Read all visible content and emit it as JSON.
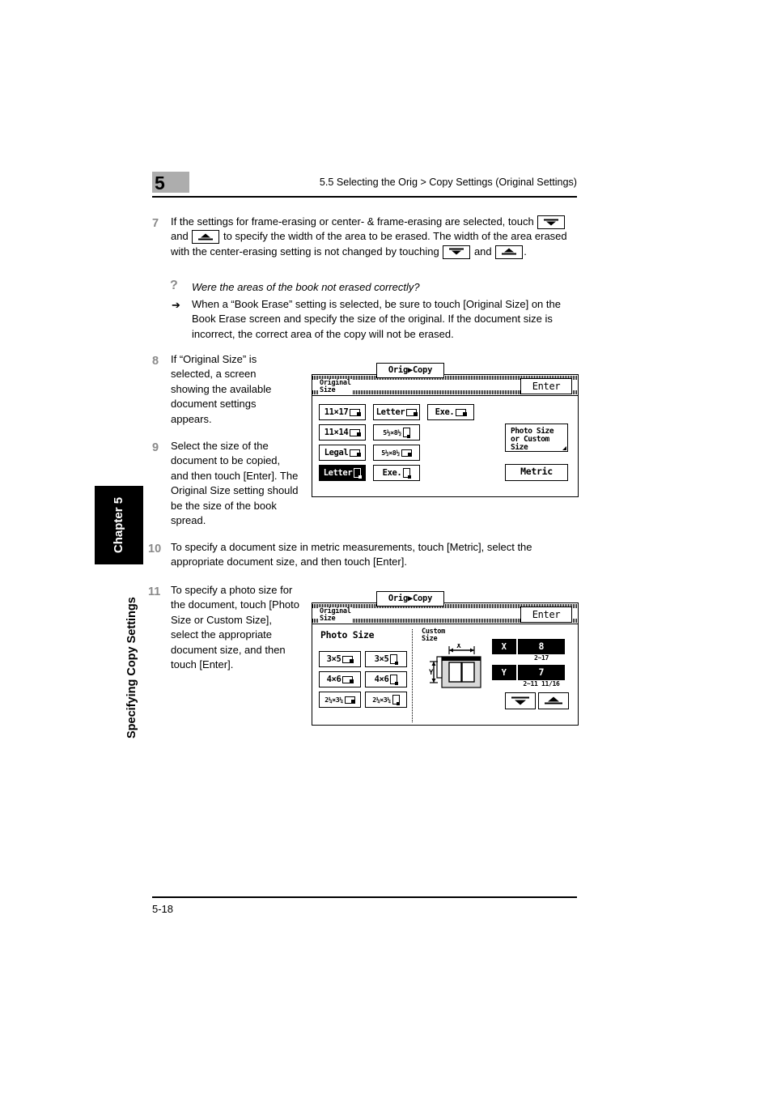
{
  "header": {
    "chapter_number": "5",
    "title": "5.5 Selecting the Orig > Copy Settings (Original Settings)"
  },
  "sidebar": {
    "chapter_tab": "Chapter 5",
    "section_title": "Specifying Copy Settings"
  },
  "footer": {
    "page_number": "5-18"
  },
  "steps": {
    "s7": {
      "number": "7",
      "part1": "If the settings for frame-erasing or center- & frame-erasing are selected, touch",
      "part2": "and",
      "part3": "to specify the width of the area to be erased. The width of the area erased with the center-erasing setting is not changed by touching",
      "part4": "and",
      "part5": "."
    },
    "s8": {
      "number": "8",
      "text": "If “Original Size” is selected, a screen showing the available document settings appears."
    },
    "s9": {
      "number": "9",
      "text": "Select the size of the document to be copied, and then touch [Enter]. The Original Size setting should be the size of the book spread."
    },
    "s10": {
      "number": "10",
      "text": "To specify a document size in metric measurements, touch [Metric], select the appropriate document size, and then touch [Enter]."
    },
    "s11": {
      "number": "11",
      "text": "To specify a photo size for the document, touch [Photo Size or Custom Size], select the appropriate document size, and then touch [Enter]."
    }
  },
  "qa": {
    "mark": "?",
    "arrow": "➔",
    "question": "Were the areas of the book not erased correctly?",
    "answer": "When a “Book Erase” setting is selected, be sure to touch [Original Size] on the Book Erase screen and specify the size of the original. If the document size is incorrect, the correct area of the copy will not be erased."
  },
  "screen1": {
    "tab_label": "Orig▶Copy",
    "title_line1": "Original",
    "title_line2": "Size",
    "enter_label": "Enter",
    "size_buttons": [
      {
        "label": "11×17",
        "orientation": "land",
        "selected": false
      },
      {
        "label": "Letter",
        "orientation": "land",
        "selected": false
      },
      {
        "label": "Exe.",
        "orientation": "land",
        "selected": false
      },
      {
        "label": "11×14",
        "orientation": "land",
        "selected": false
      },
      {
        "label": "5½×8½",
        "orientation": "port",
        "selected": false
      },
      {
        "label": "Legal",
        "orientation": "land",
        "selected": false
      },
      {
        "label": "5½×8½",
        "orientation": "land",
        "selected": false
      },
      {
        "label": "Letter",
        "orientation": "port",
        "selected": true
      },
      {
        "label": "Exe.",
        "orientation": "port",
        "selected": false
      }
    ],
    "photo_custom_button": {
      "line1": "Photo Size",
      "line2": "or Custom",
      "line3": "Size"
    },
    "metric_button": "Metric"
  },
  "screen2": {
    "tab_label": "Orig▶Copy",
    "title_line1": "Original",
    "title_line2": "Size",
    "enter_label": "Enter",
    "photo_size_label": "Photo Size",
    "custom_size_label_line1": "Custom",
    "custom_size_label_line2": "Size",
    "photo_buttons": [
      {
        "label": "3×5",
        "orientation": "land"
      },
      {
        "label": "3×5",
        "orientation": "port"
      },
      {
        "label": "4×6",
        "orientation": "land"
      },
      {
        "label": "4×6",
        "orientation": "port"
      },
      {
        "label": "2¼×3¼",
        "orientation": "land"
      },
      {
        "label": "2¼×3¼",
        "orientation": "port"
      }
    ],
    "diagram": {
      "x_label": "X",
      "y_label": "Y"
    },
    "x_field": {
      "tag": "X",
      "value": "8",
      "range": "2~17"
    },
    "y_field": {
      "tag": "Y",
      "value": "7",
      "range": "2~11 11/16"
    }
  }
}
